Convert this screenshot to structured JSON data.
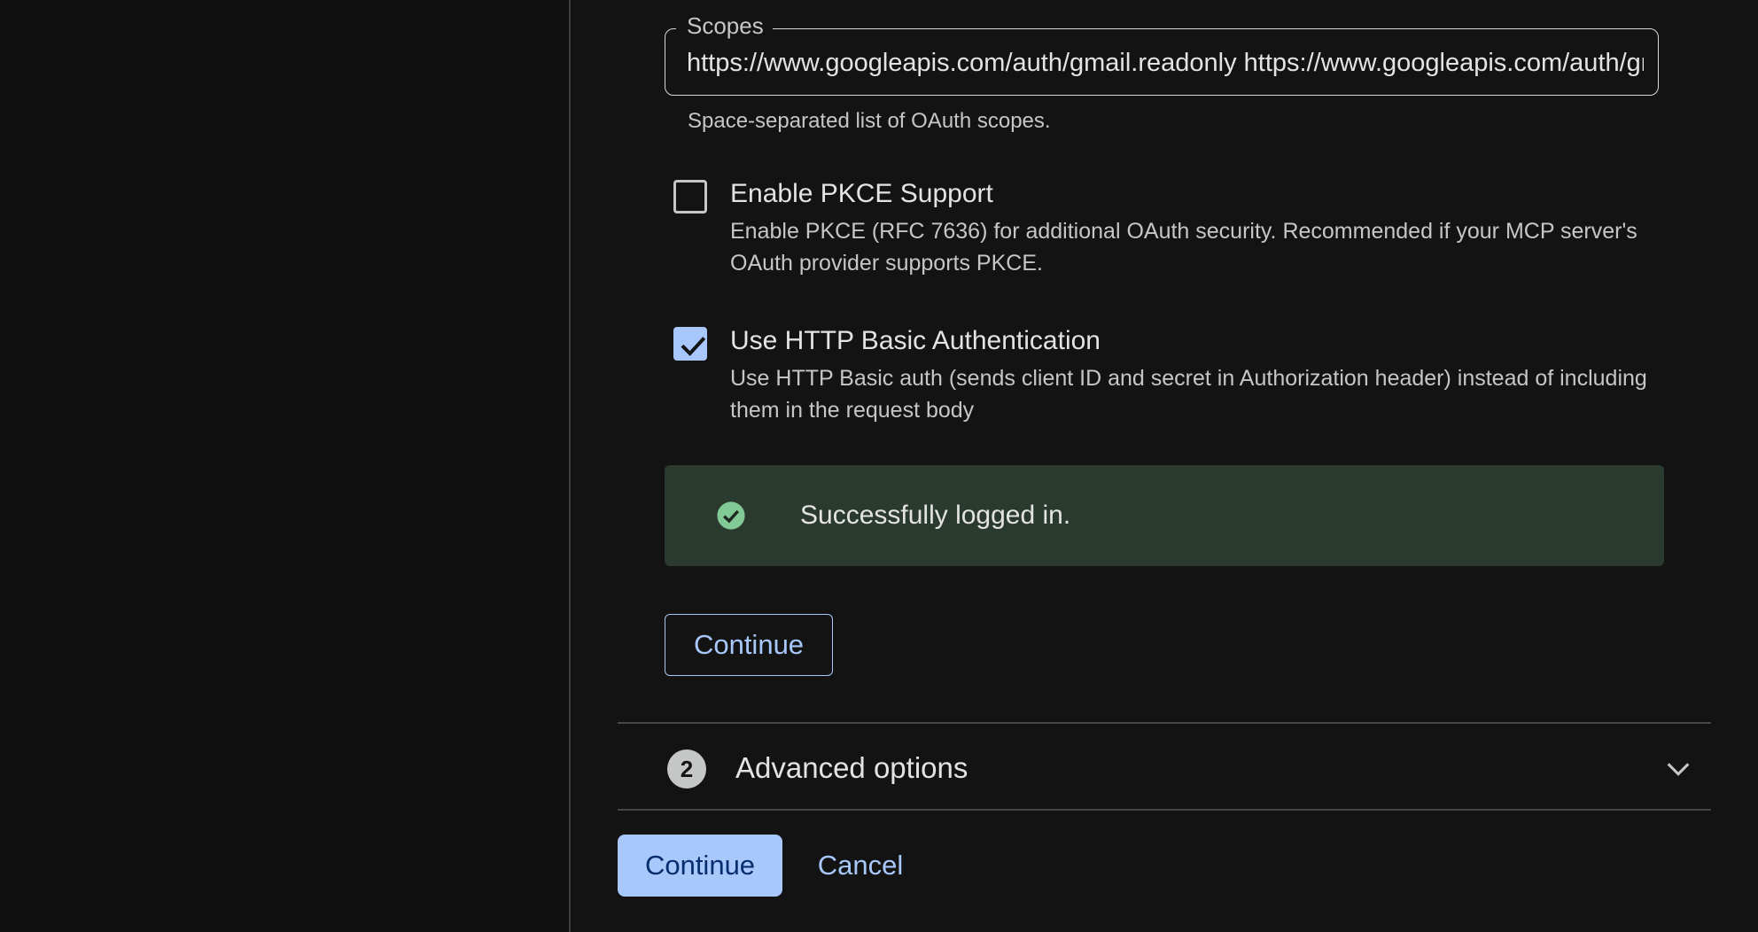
{
  "scopes": {
    "label": "Scopes",
    "value": "https://www.googleapis.com/auth/gmail.readonly https://www.googleapis.com/auth/gmail.send",
    "helper": "Space-separated list of OAuth scopes."
  },
  "pkce": {
    "checked": false,
    "title": "Enable PKCE Support",
    "description": "Enable PKCE (RFC 7636) for additional OAuth security. Recommended if your MCP server's OAuth provider supports PKCE."
  },
  "basic_auth": {
    "checked": true,
    "title": "Use HTTP Basic Authentication",
    "description": "Use HTTP Basic auth (sends client ID and secret in Authorization header) instead of including them in the request body"
  },
  "status": {
    "message": "Successfully logged in.",
    "icon": "check-circle-icon",
    "color": "#81c995"
  },
  "step_continue_label": "Continue",
  "advanced": {
    "step_number": "2",
    "label": "Advanced options",
    "icon": "chevron-down-icon"
  },
  "actions": {
    "continue_label": "Continue",
    "cancel_label": "Cancel"
  },
  "colors": {
    "accent": "#a8c7fa",
    "background": "#131314",
    "success_bg": "#2a3a2e"
  }
}
